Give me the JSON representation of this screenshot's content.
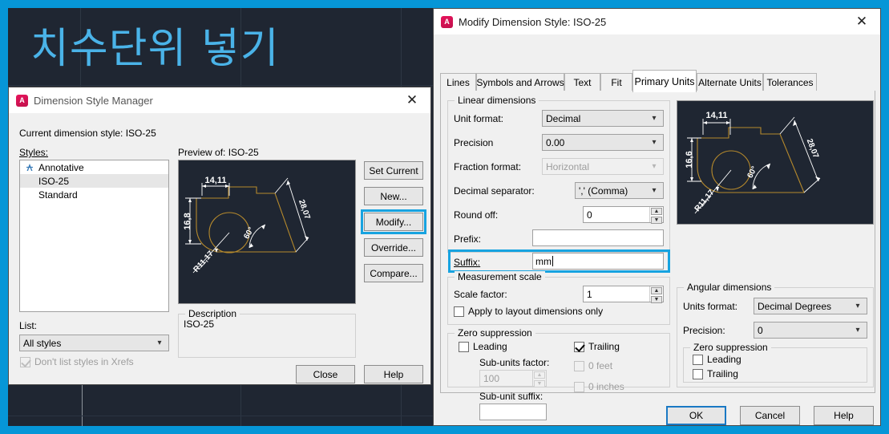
{
  "workspace": {
    "title": "치수단위 넣기",
    "bg_color": "#1f2632",
    "accent_color": "#0696d7",
    "title_color": "#4ab3e8"
  },
  "dimension_style_manager": {
    "title": "Dimension Style Manager",
    "icon": "autocad-icon",
    "close_icon": "close-icon",
    "current_style_label": "Current dimension style: ISO-25",
    "styles_label": "Styles:",
    "styles": [
      {
        "label": "Annotative",
        "icon": "annotative-icon",
        "selected": false
      },
      {
        "label": "ISO-25",
        "icon": "",
        "selected": true
      },
      {
        "label": "Standard",
        "icon": "",
        "selected": false
      }
    ],
    "preview_label": "Preview of: ISO-25",
    "preview_dims": {
      "top": "14,11",
      "left": "16,8",
      "diagonal": "28,07",
      "angle": "60°",
      "radius": "R11,17"
    },
    "buttons": {
      "set_current": "Set Current",
      "new": "New...",
      "modify": "Modify...",
      "override": "Override...",
      "compare": "Compare..."
    },
    "modify_highlighted": true,
    "list_label": "List:",
    "list_value": "All styles",
    "xrefs_checkbox": "Don't list styles in Xrefs",
    "description_label": "Description",
    "description_value": "ISO-25",
    "footer": {
      "close": "Close",
      "help": "Help"
    }
  },
  "modify_dimension_style": {
    "title": "Modify Dimension Style: ISO-25",
    "icon": "autocad-icon",
    "close_icon": "close-icon",
    "tabs": [
      {
        "label": "Lines",
        "active": false
      },
      {
        "label": "Symbols and Arrows",
        "active": false
      },
      {
        "label": "Text",
        "active": false
      },
      {
        "label": "Fit",
        "active": false
      },
      {
        "label": "Primary Units",
        "active": true
      },
      {
        "label": "Alternate Units",
        "active": false
      },
      {
        "label": "Tolerances",
        "active": false
      }
    ],
    "linear_dimensions": {
      "group_title": "Linear dimensions",
      "unit_format_label": "Unit format:",
      "unit_format_value": "Decimal",
      "precision_label": "Precision",
      "precision_value": "0.00",
      "fraction_format_label": "Fraction format:",
      "fraction_format_value": "Horizontal",
      "fraction_format_disabled": true,
      "decimal_separator_label": "Decimal separator:",
      "decimal_separator_value": "',' (Comma)",
      "round_off_label": "Round off:",
      "round_off_value": "0",
      "prefix_label": "Prefix:",
      "prefix_value": "",
      "suffix_label": "Suffix:",
      "suffix_value": "mm",
      "suffix_highlighted": true
    },
    "measurement_scale": {
      "group_title": "Measurement scale",
      "scale_factor_label": "Scale factor:",
      "scale_factor_value": "1",
      "apply_layout_label": "Apply to layout dimensions only",
      "apply_layout_checked": false
    },
    "zero_suppression": {
      "group_title": "Zero suppression",
      "leading_label": "Leading",
      "leading_checked": false,
      "trailing_label": "Trailing",
      "trailing_checked": true,
      "sub_units_factor_label": "Sub-units factor:",
      "sub_units_factor_value": "100",
      "sub_units_factor_disabled": true,
      "sub_unit_suffix_label": "Sub-unit suffix:",
      "sub_unit_suffix_value": "",
      "feet_label": "0 feet",
      "feet_checked": false,
      "inches_label": "0 inches",
      "inches_checked": false
    },
    "preview_dims": {
      "top": "14,11",
      "left": "16,6",
      "diagonal": "28,07",
      "angle": "60°",
      "radius": "R11,17"
    },
    "angular_dimensions": {
      "group_title": "Angular dimensions",
      "units_format_label": "Units format:",
      "units_format_value": "Decimal Degrees",
      "precision_label": "Precision:",
      "precision_value": "0",
      "zero_suppression_title": "Zero suppression",
      "leading_label": "Leading",
      "leading_checked": false,
      "trailing_label": "Trailing",
      "trailing_checked": false
    },
    "footer": {
      "ok": "OK",
      "cancel": "Cancel",
      "help": "Help"
    }
  }
}
